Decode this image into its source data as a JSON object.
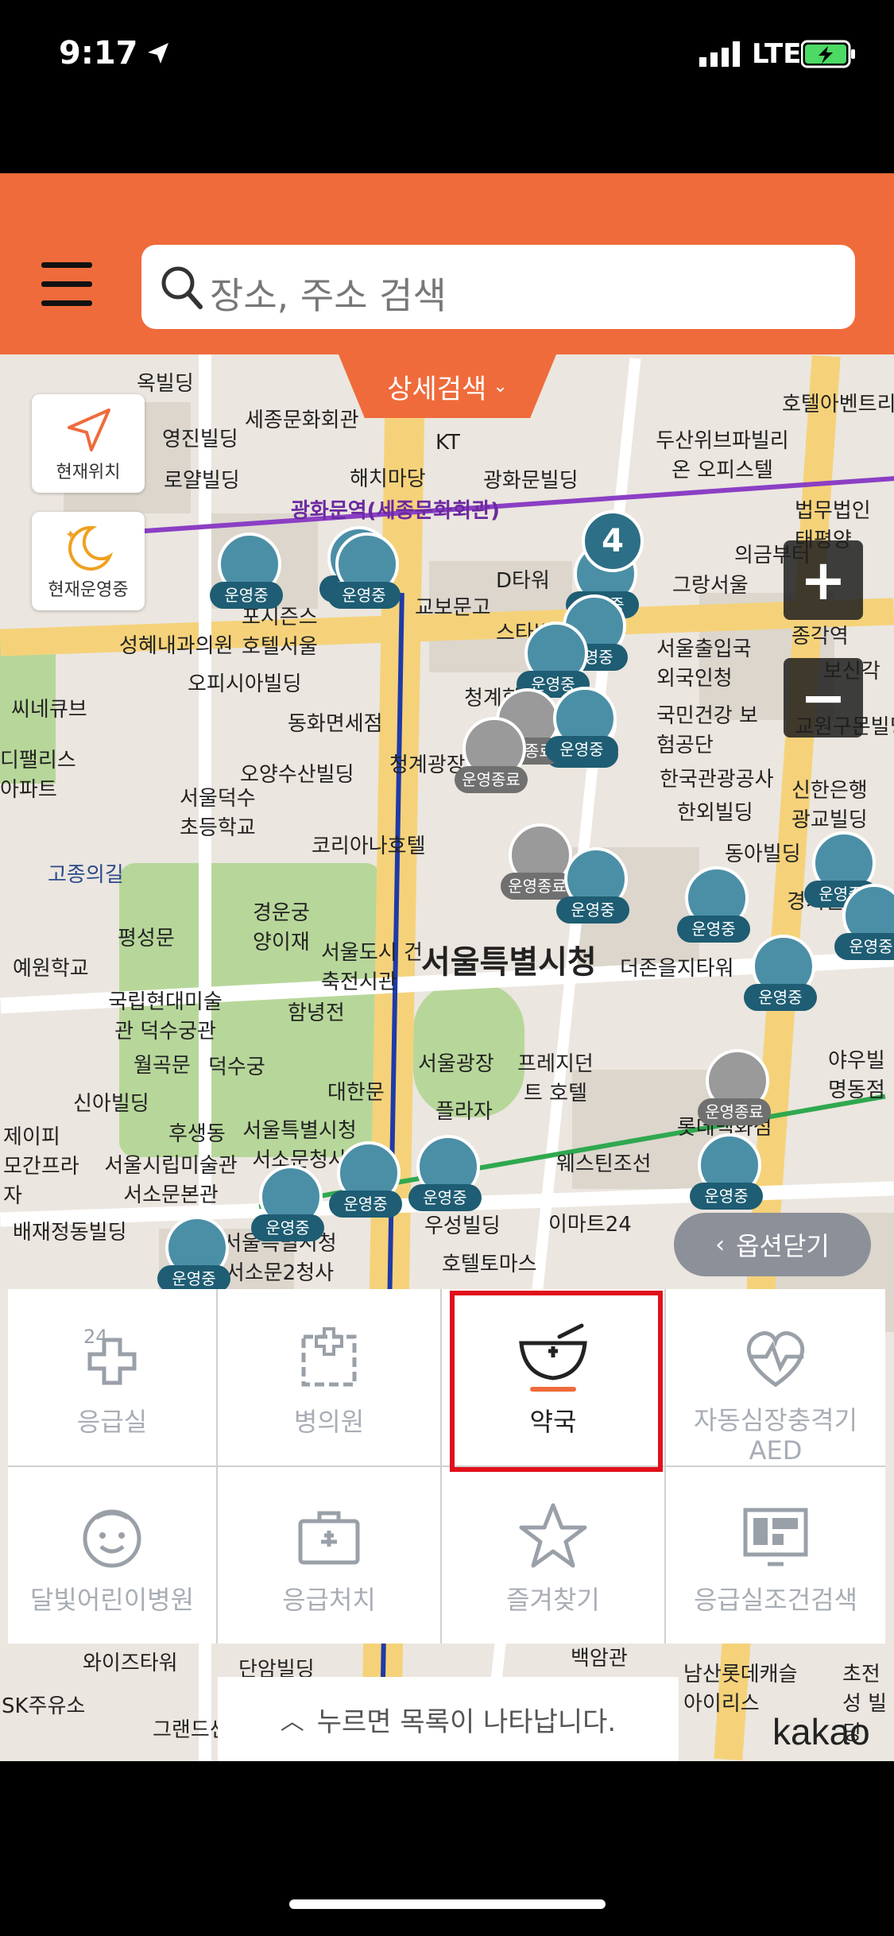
{
  "status_bar": {
    "time": "9:17",
    "network": "LTE"
  },
  "header": {
    "search_placeholder": "장소, 주소 검색",
    "detail_search": "상세검색"
  },
  "map": {
    "current_location": "현재위치",
    "open_now": "현재운영중",
    "option_close": "옵션닫기",
    "cluster_count": "4",
    "brand": "kakao",
    "labels": [
      "세종문화회관",
      "광화문빌딩",
      "KT",
      "해치마당",
      "두산위브파빌리온 오피스텔",
      "호텔아벤트리",
      "영진빌딩",
      "로얄빌딩",
      "광화문역(세종문화회관)",
      "법무법인 태평양",
      "의금부터",
      "교보문고",
      "D타워",
      "그랑서울",
      "성혜내과의원",
      "포시즌스 호텔서울",
      "스타벅스",
      "종각역",
      "서울출입국 외국인청",
      "보신각",
      "오피시아빌딩",
      "씨네큐브",
      "동화면세점",
      "청계한",
      "국민건강 보험공단",
      "교원구몬빌딩",
      "디팰리스 아파트",
      "오양수산빌딩",
      "서울덕수 초등학교",
      "청계광장",
      "한국관광공사",
      "한외빌딩",
      "신한은행 광교빌딩",
      "고종의길",
      "코리아나호텔",
      "동아빌딩",
      "경기빌딩",
      "평성문",
      "경운궁 양이재",
      "서울도시 건축전시관",
      "서울특별시청",
      "더존을지타워",
      "예원학교",
      "국립현대미술관 덕수궁관",
      "함녕전",
      "월곡문",
      "덕수궁",
      "서울광장",
      "프레지던트 호텔",
      "신아빌딩",
      "대한문",
      "야우빌 명동점",
      "제이피 모간프라자",
      "후생동",
      "서울특별시청 서소문청사",
      "서울시립미술관 서소문본관",
      "플라자",
      "롯데백화점",
      "웨스틴조선",
      "배재정동빌딩",
      "서울특별시청 서소문2청사",
      "우성빌딩",
      "이마트24",
      "호텔토마스",
      "와이즈타워",
      "단암빌딩",
      "백암관",
      "남산롯데캐슬 아이리스",
      "초전성 빌딩",
      "SK주유소",
      "그랜드센"
    ],
    "markers": [
      "운영중",
      "운영중",
      "운영중",
      "운영중",
      "운영중",
      "운영중",
      "운영중",
      "운영중",
      "운영중",
      "운영종료",
      "운영종료",
      "운영중",
      "운영중",
      "운영종료",
      "운영중",
      "운영중",
      "운영중",
      "운영중",
      "운영중",
      "운영종료",
      "운영중",
      "운영중",
      "운영중",
      "운영중",
      "운영중"
    ]
  },
  "categories": [
    {
      "label": "응급실",
      "icon": "emergency-24-icon",
      "selected": false
    },
    {
      "label": "병의원",
      "icon": "hospital-icon",
      "selected": false
    },
    {
      "label": "약국",
      "icon": "pharmacy-bowl-icon",
      "selected": true
    },
    {
      "label": "자동심장충격기 AED",
      "icon": "heartbeat-icon",
      "selected": false
    },
    {
      "label": "달빛어린이병원",
      "icon": "child-face-icon",
      "selected": false
    },
    {
      "label": "응급처치",
      "icon": "first-aid-kit-icon",
      "selected": false
    },
    {
      "label": "즐겨찾기",
      "icon": "star-icon",
      "selected": false
    },
    {
      "label": "응급실조건검색",
      "icon": "monitor-icon",
      "selected": false
    }
  ],
  "list_hint": "누르면 목록이 나타납니다.",
  "colors": {
    "brand": "#ef6b3b",
    "selection": "#e0101c",
    "marker_open": "#1e5d73",
    "marker_closed": "#707070"
  }
}
